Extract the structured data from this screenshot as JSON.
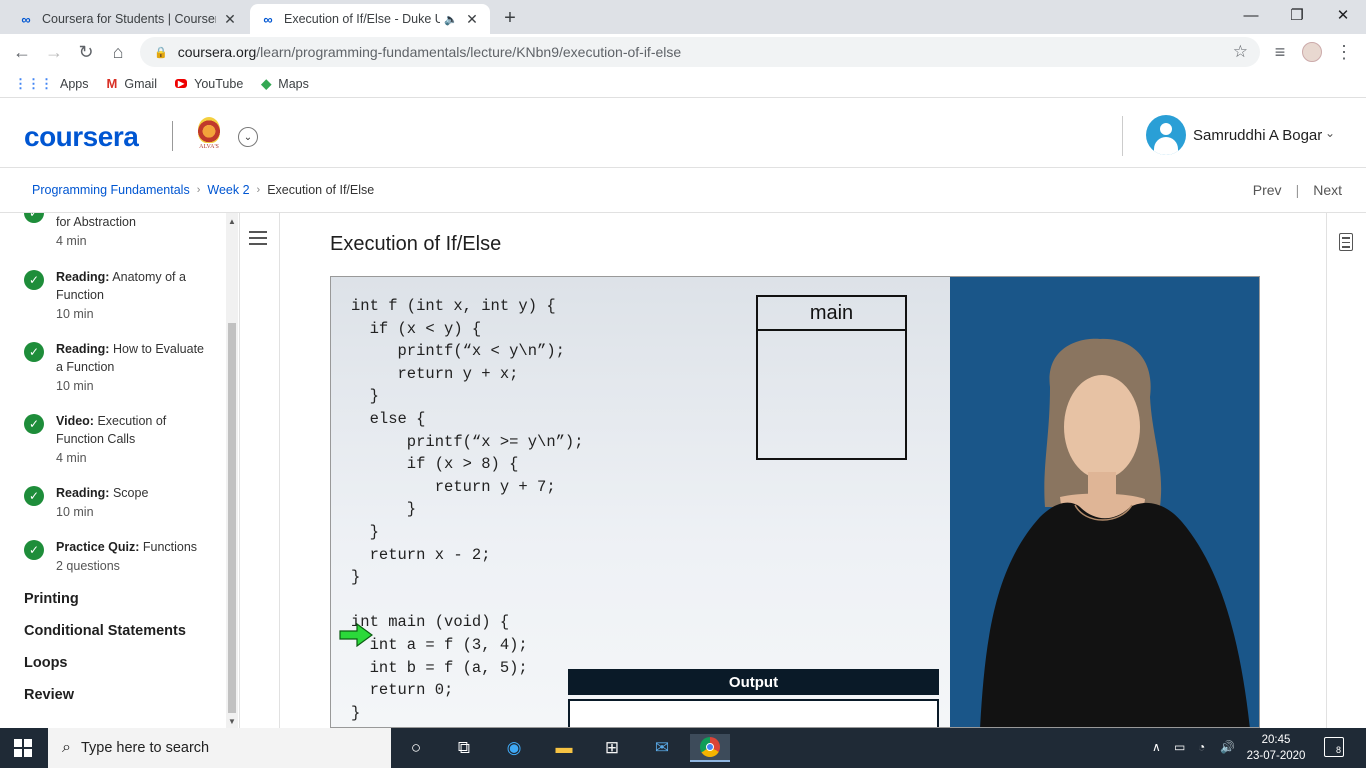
{
  "browser": {
    "tabs": [
      {
        "title": "Coursera for Students | Coursera",
        "active": false
      },
      {
        "title": "Execution of If/Else - Duke U",
        "active": true
      }
    ],
    "url_domain": "coursera.org",
    "url_path": "/learn/programming-fundamentals/lecture/KNbn9/execution-of-if-else",
    "bookmarks": [
      {
        "label": "Apps",
        "icon": "apps-grid-icon"
      },
      {
        "label": "Gmail",
        "icon": "gmail-icon"
      },
      {
        "label": "YouTube",
        "icon": "youtube-icon"
      },
      {
        "label": "Maps",
        "icon": "maps-icon"
      }
    ]
  },
  "header": {
    "logo": "coursera",
    "institution_label": "ALVA'S",
    "user_name": "Samruddhi A Bogar"
  },
  "breadcrumb": {
    "course": "Programming Fundamentals",
    "week": "Week 2",
    "current": "Execution of If/Else",
    "prev_label": "Prev",
    "next_label": "Next"
  },
  "sidebar": {
    "partial_item": {
      "label": "for Abstraction",
      "meta": "4 min"
    },
    "items": [
      {
        "type": "Reading:",
        "label": "Anatomy of a Function",
        "meta": "10 min"
      },
      {
        "type": "Reading:",
        "label": "How to Evaluate a Function",
        "meta": "10 min"
      },
      {
        "type": "Video:",
        "label": "Execution of Function Calls",
        "meta": "4 min"
      },
      {
        "type": "Reading:",
        "label": "Scope",
        "meta": "10 min"
      },
      {
        "type": "Practice Quiz:",
        "label": "Functions",
        "meta": "2 questions"
      }
    ],
    "sections": [
      "Printing",
      "Conditional Statements",
      "Loops",
      "Review"
    ]
  },
  "lecture": {
    "title": "Execution of If/Else",
    "code_lines": [
      "int f (int x, int y) {",
      "  if (x < y) {",
      "     printf(“x < y\\n”);",
      "     return y + x;",
      "  }",
      "  else {",
      "      printf(“x >= y\\n”);",
      "      if (x > 8) {",
      "         return y + 7;",
      "      }",
      "  }",
      "  return x - 2;",
      "}",
      "",
      "int main (void) {",
      "  int a = f (3, 4);",
      "  int b = f (a, 5);",
      "  return 0;",
      "}"
    ],
    "frame_label": "main",
    "output_label": "Output"
  },
  "taskbar": {
    "search_placeholder": "Type here to search",
    "time": "20:45",
    "date": "23-07-2020",
    "notification_count": "8"
  },
  "colors": {
    "coursera_blue": "#0056d2",
    "check_green": "#1e8d3a",
    "taskbar_bg": "#1f2a36",
    "presenter_bg": "#1a5689"
  }
}
